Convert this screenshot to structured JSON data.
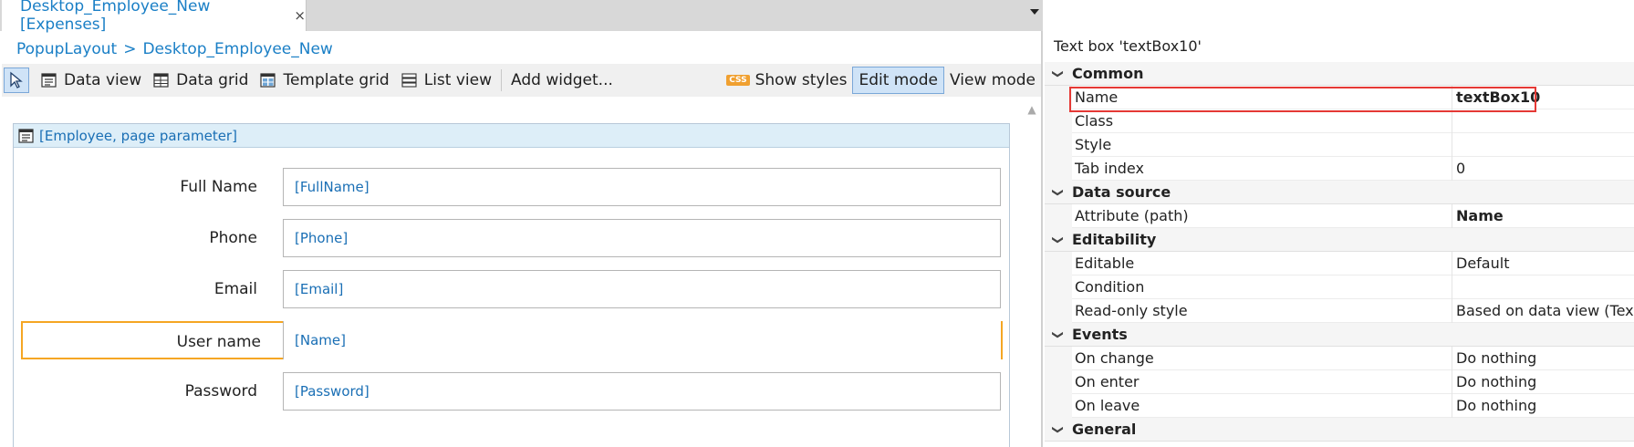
{
  "editor": {
    "tab_label": "Desktop_Employee_New [Expenses]",
    "tab_close": "×",
    "breadcrumb": {
      "parent": "PopupLayout",
      "separator": ">",
      "current": "Desktop_Employee_New"
    },
    "toolbar": {
      "data_view": "Data view",
      "data_grid": "Data grid",
      "template_grid": "Template grid",
      "list_view": "List view",
      "add_widget": "Add widget...",
      "show_styles": "Show styles",
      "css_badge": "CSS",
      "edit_mode": "Edit mode",
      "view_mode": "View mode"
    },
    "dataview_header": "[Employee, page parameter]",
    "form_rows": [
      {
        "label": "Full Name",
        "value": "[FullName]"
      },
      {
        "label": "Phone",
        "value": "[Phone]"
      },
      {
        "label": "Email",
        "value": "[Email]"
      },
      {
        "label": "User name",
        "value": "[Name]",
        "selected": true
      },
      {
        "label": "Password",
        "value": "[Password]"
      }
    ]
  },
  "properties": {
    "title": "Text box 'textBox10'",
    "groups": [
      {
        "name": "Common",
        "rows": [
          {
            "key": "Name",
            "value": "textBox10",
            "bold": true,
            "highlighted": true
          },
          {
            "key": "Class",
            "value": ""
          },
          {
            "key": "Style",
            "value": ""
          },
          {
            "key": "Tab index",
            "value": "0"
          }
        ]
      },
      {
        "name": "Data source",
        "rows": [
          {
            "key": "Attribute (path)",
            "value": "Name",
            "bold": true
          }
        ]
      },
      {
        "name": "Editability",
        "rows": [
          {
            "key": "Editable",
            "value": "Default"
          },
          {
            "key": "Condition",
            "value": ""
          },
          {
            "key": "Read-only style",
            "value": "Based on data view (Text)"
          }
        ]
      },
      {
        "name": "Events",
        "rows": [
          {
            "key": "On change",
            "value": "Do nothing"
          },
          {
            "key": "On enter",
            "value": "Do nothing"
          },
          {
            "key": "On leave",
            "value": "Do nothing"
          }
        ]
      },
      {
        "name": "General",
        "rows": []
      }
    ]
  },
  "colors": {
    "link_blue": "#1a7fc6",
    "selection_orange": "#f5a623",
    "highlight_red": "#e53935",
    "active_button_blue": "#cfe3f7"
  },
  "icons": [
    "close-icon",
    "dropdown-arrow-icon",
    "pointer-icon",
    "data-view-icon",
    "data-grid-icon",
    "template-grid-icon",
    "list-view-icon",
    "css-icon",
    "chevron-down-icon",
    "scroll-up-icon"
  ]
}
